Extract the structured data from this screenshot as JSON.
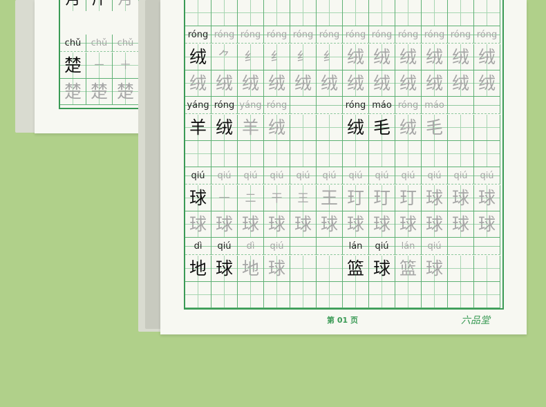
{
  "back_sheet": {
    "pinyin_row": [
      "chǔ",
      "chǔ",
      "chǔ"
    ],
    "top_chars": [
      "月",
      "斤",
      "月"
    ],
    "char_row": [
      "楚",
      "",
      ""
    ],
    "trace_row": [
      "楚",
      "楚",
      "楚"
    ]
  },
  "sheet": {
    "block1": {
      "pinyin": [
        "róng",
        "róng",
        "róng",
        "róng",
        "róng",
        "róng",
        "róng",
        "róng",
        "róng",
        "róng",
        "róng",
        "róng"
      ],
      "chars": [
        "绒",
        "",
        "",
        "",
        "",
        "",
        "绒",
        "绒",
        "绒",
        "绒",
        "绒",
        "绒"
      ],
      "strokes": [
        "",
        "⺈",
        "纟",
        "纟",
        "纟",
        "纟",
        "",
        "",
        "",
        "",
        "",
        ""
      ],
      "trace": [
        "绒",
        "绒",
        "绒",
        "绒",
        "绒",
        "绒",
        "绒",
        "绒",
        "绒",
        "绒",
        "绒",
        "绒"
      ]
    },
    "words1": {
      "pinyin": [
        "yáng",
        "róng",
        "yáng",
        "róng",
        "",
        "",
        "róng",
        "máo",
        "róng",
        "máo",
        "",
        ""
      ],
      "chars": [
        "羊",
        "绒",
        "羊",
        "绒",
        "",
        "",
        "绒",
        "毛",
        "绒",
        "毛",
        "",
        ""
      ]
    },
    "block2": {
      "pinyin": [
        "qiú",
        "qiú",
        "qiú",
        "qiú",
        "qiú",
        "qiú",
        "qiú",
        "qiú",
        "qiú",
        "qiú",
        "qiú",
        "qiú"
      ],
      "chars": [
        "球",
        "一",
        "二",
        "干",
        "王",
        "王",
        "玎",
        "玎",
        "玎",
        "球",
        "球",
        "球"
      ],
      "trace": [
        "球",
        "球",
        "球",
        "球",
        "球",
        "球",
        "球",
        "球",
        "球",
        "球",
        "球",
        "球"
      ]
    },
    "words2": {
      "pinyin": [
        "dì",
        "qiú",
        "dì",
        "qiú",
        "",
        "",
        "lán",
        "qiú",
        "lán",
        "qiú",
        "",
        ""
      ],
      "chars": [
        "地",
        "球",
        "地",
        "球",
        "",
        "",
        "篮",
        "球",
        "篮",
        "球",
        "",
        ""
      ]
    },
    "footer": {
      "page": "第 01 页",
      "brand": "六品堂"
    }
  }
}
